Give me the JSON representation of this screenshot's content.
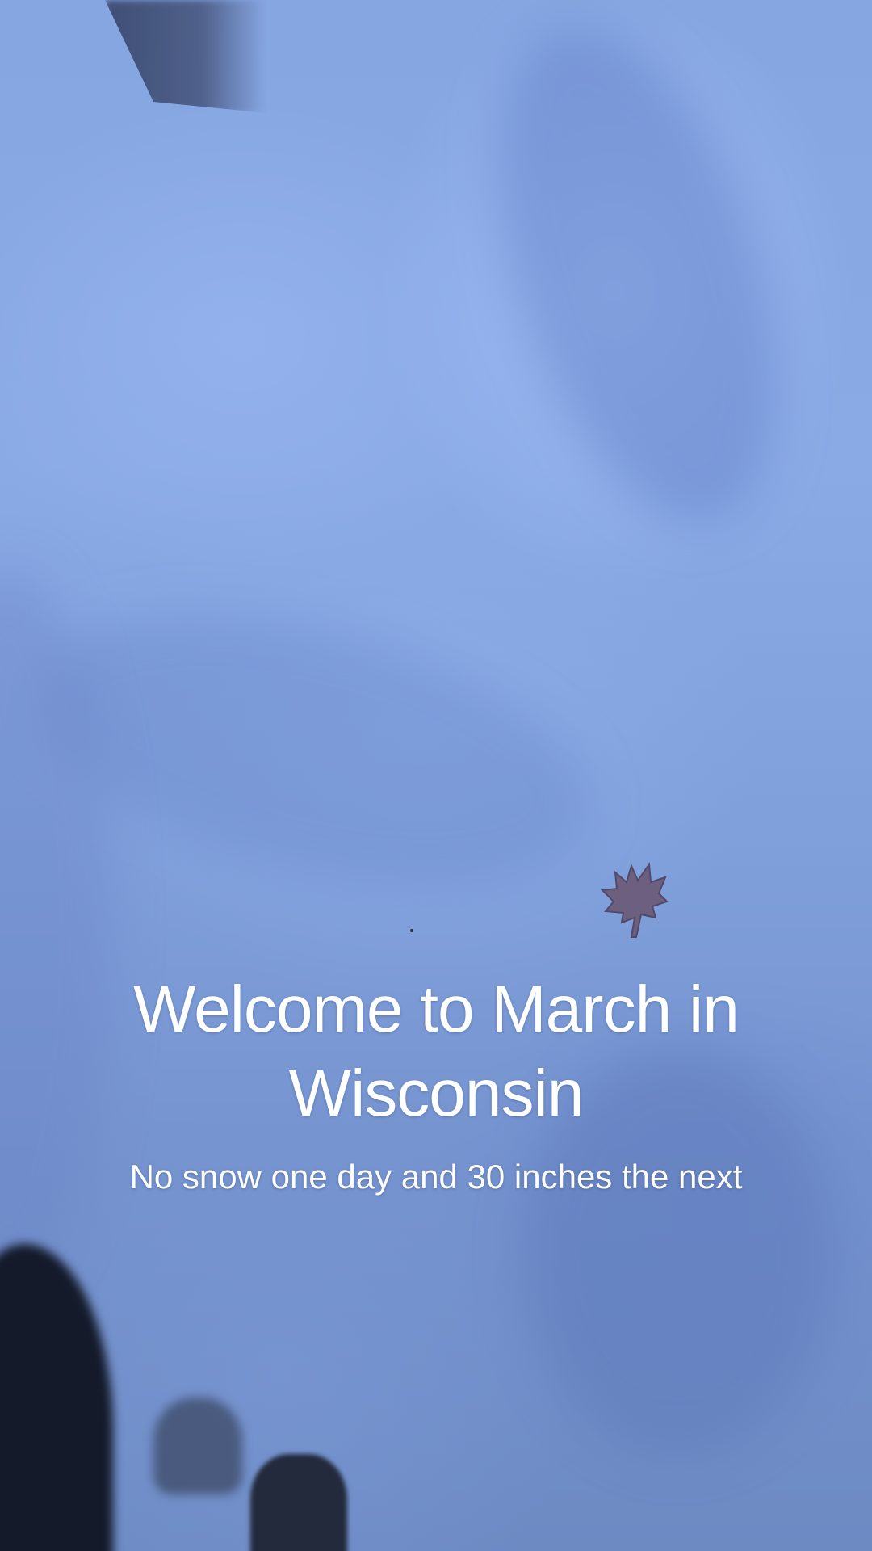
{
  "video": {
    "title_overlay": "Welcome to March in Wisconsin",
    "subtitle_overlay": "No snow one day and 30 inches the next"
  },
  "scene": {
    "subject": "snow-surface",
    "colors": {
      "snow_light": "#8aaae6",
      "snow_shadow": "#6d8ac3",
      "leaf": "#6b5a78",
      "text": "#ffffff"
    }
  }
}
